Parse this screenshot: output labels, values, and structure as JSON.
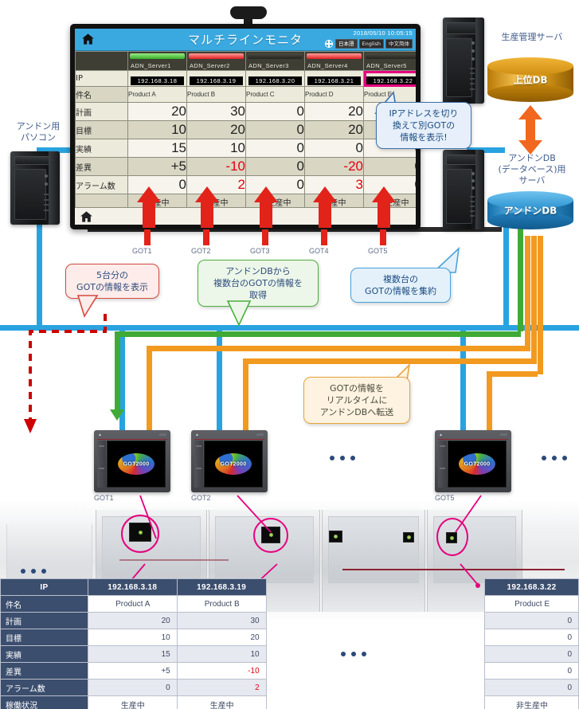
{
  "monitor": {
    "title": "マルチラインモニタ",
    "datetime": "2018/05/10  10:05:15",
    "lang_buttons": [
      "日本語",
      "English",
      "中文简体"
    ],
    "home_icon": "home-icon",
    "globe_icon": "globe-icon",
    "servers": [
      {
        "name": "ADN_Server1",
        "bar": "green"
      },
      {
        "name": "ADN_Server2",
        "bar": "red"
      },
      {
        "name": "ADN_Server3",
        "bar": "dark"
      },
      {
        "name": "ADN_Server4",
        "bar": "red"
      },
      {
        "name": "ADN_Server5",
        "bar": "dark"
      }
    ],
    "rows": {
      "ip_label": "IP",
      "ip_values": [
        "192.168.3.18",
        "192.168.3.19",
        "192.168.3.20",
        "192.168.3.21",
        "192.168.3.22"
      ],
      "selected_ip_index": 4,
      "name_label": "件名",
      "name_values": [
        "Product A",
        "Product B",
        "Product C",
        "Product D",
        "Product E"
      ],
      "plan_label": "計画",
      "plan_values": [
        "20",
        "30",
        "0",
        "20",
        ""
      ],
      "target_label": "目標",
      "target_values": [
        "10",
        "20",
        "0",
        "20",
        ""
      ],
      "actual_label": "実績",
      "actual_values": [
        "15",
        "10",
        "0",
        "0",
        "0"
      ],
      "diff_label": "差異",
      "diff_values": [
        "+5",
        "-10",
        "0",
        "-20",
        "0"
      ],
      "diff_negative": [
        false,
        true,
        false,
        true,
        false
      ],
      "alarm_label": "アラーム数",
      "alarm_values": [
        "0",
        "2",
        "0",
        "3",
        "0"
      ],
      "alarm_negative": [
        false,
        true,
        false,
        true,
        false
      ],
      "status_values": [
        "生産中",
        "生産中",
        "非生産中",
        "生産中",
        "非生産中"
      ]
    }
  },
  "got_tick_labels": [
    "GOT1",
    "GOT2",
    "GOT3",
    "GOT4",
    "GOT5"
  ],
  "devices": {
    "andon_pc_label": "アンドン用\nパソコン",
    "andon_pc_label_l1": "アンドン用",
    "andon_pc_label_l2": "パソコン",
    "prod_server_label": "生産管理サーバ",
    "upper_db_label": "上位DB",
    "andon_server_label_l1": "アンドンDB",
    "andon_server_label_l2": "(データベース)用",
    "andon_server_label_l3": "サーバ",
    "andon_db_label": "アンドンDB"
  },
  "callouts": {
    "ip_switch": "IPアドレスを切り\n換えて別GOTの\n情報を表示!",
    "ip_switch_l1": "IPアドレスを切り",
    "ip_switch_l2": "換えて別GOTの",
    "ip_switch_l3": "情報を表示!",
    "five_units_l1": "5台分の",
    "five_units_l2": "GOTの情報を表示",
    "from_db_l1": "アンドンDBから",
    "from_db_l2": "複数台のGOTの情報を",
    "from_db_l3": "取得",
    "aggregate_l1": "複数台の",
    "aggregate_l2": "GOTの情報を集約",
    "realtime_l1": "GOTの情報を",
    "realtime_l2": "リアルタイムに",
    "realtime_l3": "アンドンDBへ転送"
  },
  "got_units": [
    {
      "label": "GOT1",
      "logo": "GOT2000"
    },
    {
      "label": "GOT2",
      "logo": "GOT2000"
    },
    {
      "label": "GOT5",
      "logo": "GOT2000"
    }
  ],
  "bottom_table": {
    "row_labels": [
      "IP",
      "件名",
      "計画",
      "目標",
      "実績",
      "差異",
      "アラーム数",
      "稼働状況"
    ],
    "columns": [
      {
        "ip": "192.168.3.18",
        "name": "Product A",
        "plan": "20",
        "target": "10",
        "actual": "15",
        "diff": "+5",
        "alarm": "0",
        "status": "生産中",
        "diff_neg": false,
        "alarm_neg": false
      },
      {
        "ip": "192.168.3.19",
        "name": "Product B",
        "plan": "30",
        "target": "20",
        "actual": "10",
        "diff": "-10",
        "alarm": "2",
        "status": "生産中",
        "diff_neg": true,
        "alarm_neg": true
      },
      {
        "ip": "192.168.3.22",
        "name": "Product E",
        "plan": "0",
        "target": "0",
        "actual": "0",
        "diff": "0",
        "alarm": "0",
        "status": "非生産中",
        "diff_neg": false,
        "alarm_neg": false
      }
    ]
  },
  "colors": {
    "accent_pink": "#e6007e",
    "net_blue": "#29a3e0",
    "net_green": "#3faa35",
    "net_orange": "#f29a1f",
    "header_blue": "#3aa9e0",
    "table_navy": "#3c4e6e",
    "alarm_red": "#e3000f"
  }
}
